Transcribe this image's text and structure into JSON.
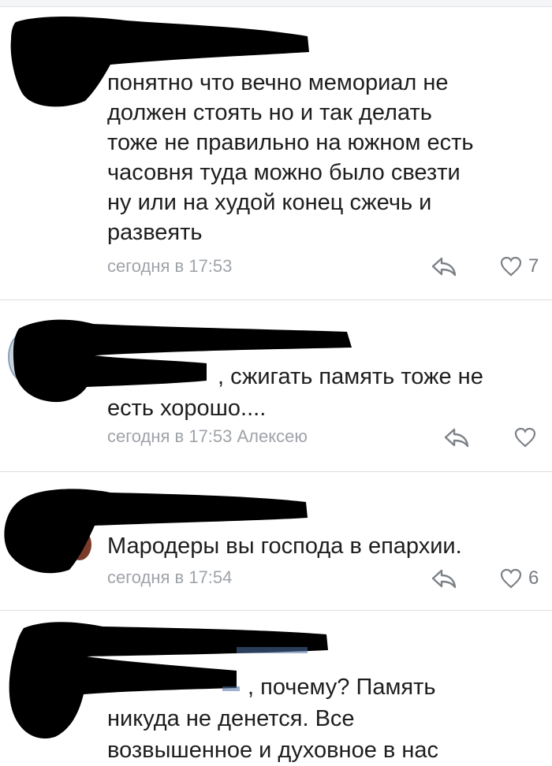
{
  "comments": [
    {
      "text": "понятно что вечно мемориал не\nдолжен стоять но и так делать\nтоже не правильно на южном есть\nчасовня туда можно было свезти\nну или на худой конец сжечь и\nразвеять",
      "timestamp": "сегодня в 17:53",
      "likes": "7"
    },
    {
      "text_suffix": ", сжигать память тоже не",
      "text_line2": "есть хорошо....",
      "timestamp": "сегодня в 17:53 Алексею",
      "likes": ""
    },
    {
      "text": "Мародеры вы господа в епархии.",
      "timestamp": "сегодня в 17:54",
      "likes": "6"
    },
    {
      "text_suffix": ", почему? Память",
      "text_line2": "никуда не денется. Все",
      "text_line3": "возвышенное и духовное в нас"
    }
  ],
  "icons": {
    "reply": "reply-arrow-icon",
    "like": "heart-outline-icon"
  },
  "colors": {
    "text": "#1e1e1e",
    "meta": "#9fa3a9",
    "divider": "#dcdee2",
    "redaction": "#000000"
  }
}
